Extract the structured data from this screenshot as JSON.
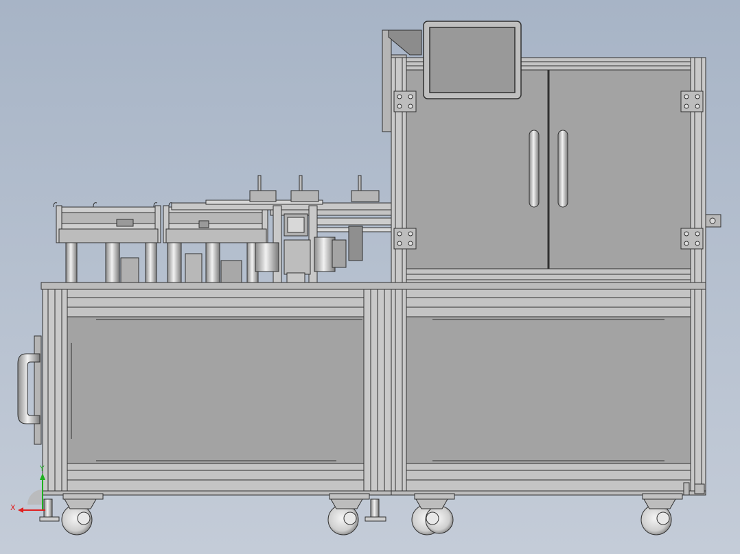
{
  "viewport": {
    "background_top": "#a7b4c6",
    "background_bottom": "#c4ccd8"
  },
  "model": {
    "panel_color": "#a3a3a3",
    "frame_color": "#c7c7c7",
    "edge_color": "#303030",
    "screen_color": "#989898"
  },
  "triad": {
    "x_label": "X",
    "y_label": "Y",
    "x_color": "#e02020",
    "y_color": "#20b020"
  }
}
